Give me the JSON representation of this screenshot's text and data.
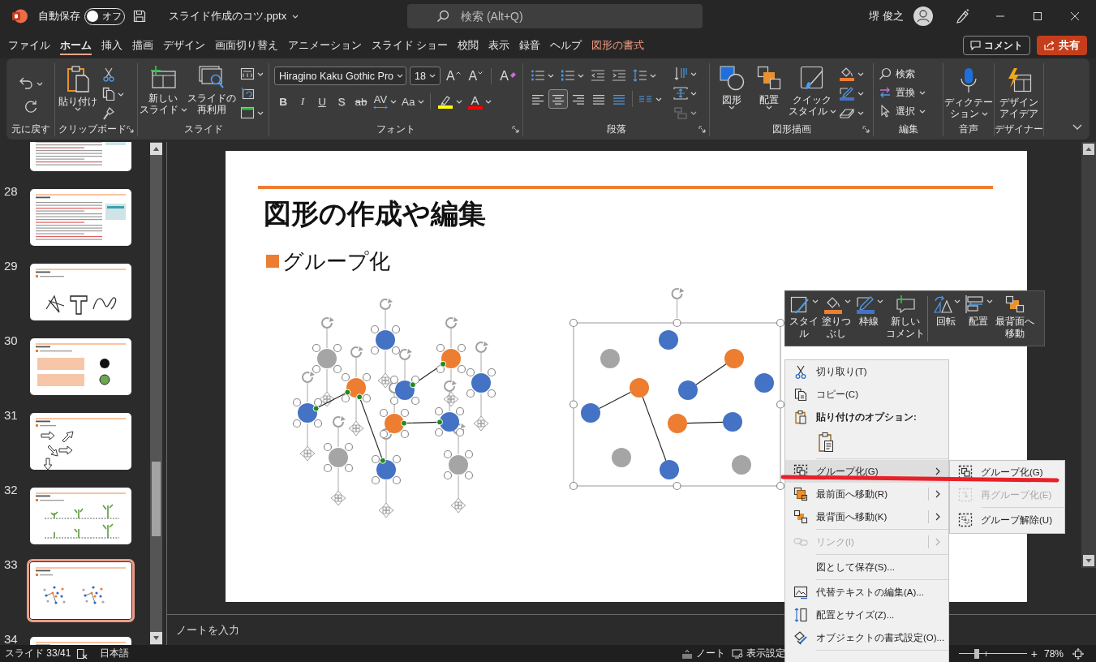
{
  "title_bar": {
    "autosave_label": "自動保存",
    "autosave": {
      "on": false,
      "label": "オフ"
    },
    "file_name": "スライド作成のコツ.pptx",
    "search": {
      "placeholder": "検索 (Alt+Q)"
    },
    "user_name": "堺 俊之"
  },
  "ribbon_tabs": [
    {
      "label": "ファイル",
      "kind": "standard",
      "selected": false
    },
    {
      "label": "ホーム",
      "kind": "standard",
      "selected": true
    },
    {
      "label": "挿入",
      "kind": "standard",
      "selected": false
    },
    {
      "label": "描画",
      "kind": "standard",
      "selected": false
    },
    {
      "label": "デザイン",
      "kind": "standard",
      "selected": false
    },
    {
      "label": "画面切り替え",
      "kind": "standard",
      "selected": false
    },
    {
      "label": "アニメーション",
      "kind": "standard",
      "selected": false
    },
    {
      "label": "スライド ショー",
      "kind": "standard",
      "selected": false
    },
    {
      "label": "校閲",
      "kind": "standard",
      "selected": false
    },
    {
      "label": "表示",
      "kind": "standard",
      "selected": false
    },
    {
      "label": "録音",
      "kind": "standard",
      "selected": false
    },
    {
      "label": "ヘルプ",
      "kind": "standard",
      "selected": false
    },
    {
      "label": "図形の書式",
      "kind": "contextual",
      "selected": false
    }
  ],
  "header_buttons": {
    "comment": "コメント",
    "share": "共有"
  },
  "ribbon": {
    "undo": {
      "group_label": "元に戻す"
    },
    "clipboard": {
      "group_label": "クリップボード",
      "paste": "貼り付け"
    },
    "slides": {
      "group_label": "スライド",
      "new_slide": [
        "新しい",
        "スライド"
      ],
      "reuse_slides": [
        "スライドの",
        "再利用"
      ]
    },
    "font": {
      "group_label": "フォント",
      "font_name": "Hiragino Kaku Gothic Pro",
      "font_size": "18",
      "grow": "A",
      "shrink": "A",
      "clear": "A",
      "styles": [
        "B",
        "I",
        "U",
        "S",
        "ab"
      ],
      "spacing": "AV",
      "case": "Aa",
      "paint": "A"
    },
    "paragraph": {
      "group_label": "段落",
      "alignment": [
        {
          "selected": false
        },
        {
          "selected": true
        },
        {
          "selected": false
        },
        {
          "selected": false
        },
        {
          "selected": false
        }
      ]
    },
    "drawing": {
      "group_label": "図形描画",
      "shapes": "図形",
      "arrange": "配置",
      "quick_styles": [
        "クイック",
        "スタイル"
      ]
    },
    "editing": {
      "group_label": "編集",
      "find": "検索",
      "replace": "置換",
      "select": "選択"
    },
    "voice": {
      "group_label": "音声",
      "dictate": [
        "ディクテー",
        "ション"
      ]
    },
    "designer": {
      "group_label": "デザイナー",
      "design_ideas": [
        "デザイン",
        "アイデア"
      ]
    }
  },
  "thumbnails": [
    {
      "kind": "text",
      "selected": false
    },
    {
      "number": "28",
      "kind": "text",
      "selected": false
    },
    {
      "number": "29",
      "kind": "freeform",
      "selected": false
    },
    {
      "number": "30",
      "kind": "boxes",
      "selected": false
    },
    {
      "number": "31",
      "kind": "arrows",
      "selected": false
    },
    {
      "number": "32",
      "kind": "plants",
      "selected": false
    },
    {
      "number": "33",
      "kind": "dots",
      "selected": true
    },
    {
      "number": "34",
      "kind": "text",
      "selected": false
    }
  ],
  "slide": {
    "title": "図形の作成や編集",
    "bullet": "グループ化",
    "diagrams": [
      {
        "grouped": false,
        "nodes": [
          {
            "color": "#a5a5a5"
          },
          {
            "color": "#4472c4"
          },
          {
            "color": "#ed7d31"
          },
          {
            "color": "#4472c4"
          },
          {
            "color": "#ed7d31"
          },
          {
            "color": "#4472c4"
          },
          {
            "color": "#4472c4"
          },
          {
            "color": "#ed7d31"
          },
          {
            "color": "#4472c4"
          },
          {
            "color": "#a5a5a5"
          },
          {
            "color": "#4472c4"
          },
          {
            "color": "#a5a5a5"
          }
        ]
      },
      {
        "grouped": true,
        "nodes": [
          {
            "color": "#a5a5a5"
          },
          {
            "color": "#4472c4"
          },
          {
            "color": "#ed7d31"
          },
          {
            "color": "#4472c4"
          },
          {
            "color": "#ed7d31"
          },
          {
            "color": "#4472c4"
          },
          {
            "color": "#4472c4"
          },
          {
            "color": "#ed7d31"
          },
          {
            "color": "#4472c4"
          },
          {
            "color": "#a5a5a5"
          },
          {
            "color": "#4472c4"
          },
          {
            "color": "#a5a5a5"
          }
        ]
      }
    ]
  },
  "notes": {
    "placeholder": "ノートを入力"
  },
  "mini_toolbar": {
    "buttons": [
      {
        "lines": [
          "スタイ",
          "ル"
        ],
        "dropdown": true
      },
      {
        "lines": [
          "塗りつ",
          "ぶし"
        ],
        "dropdown": true
      },
      {
        "lines": [
          "枠線"
        ],
        "dropdown": true
      },
      {
        "lines": [
          "新しい",
          "コメント"
        ],
        "dropdown": false
      },
      {
        "lines": [
          "回転"
        ],
        "dropdown": true
      },
      {
        "lines": [
          "配置"
        ],
        "dropdown": true
      },
      {
        "lines": [
          "最背面へ",
          "移動"
        ],
        "dropdown": false
      }
    ]
  },
  "context_menu": {
    "items": [
      {
        "kind": "command",
        "label": "切り取り(T)",
        "disabled": false
      },
      {
        "kind": "command",
        "label": "コピー(C)",
        "disabled": false
      },
      {
        "kind": "header",
        "label": "貼り付けのオプション:"
      },
      {
        "kind": "paste_options"
      },
      {
        "kind": "separator"
      },
      {
        "kind": "submenu",
        "label": "グループ化(G)",
        "disabled": false,
        "expanded": true
      },
      {
        "kind": "split",
        "label": "最前面へ移動(R)",
        "disabled": false,
        "expanded": false
      },
      {
        "kind": "split",
        "label": "最背面へ移動(K)",
        "disabled": false,
        "expanded": false
      },
      {
        "kind": "separator"
      },
      {
        "kind": "split",
        "label": "リンク(I)",
        "disabled": true,
        "expanded": false
      },
      {
        "kind": "separator"
      },
      {
        "kind": "command",
        "label": "図として保存(S)...",
        "disabled": false
      },
      {
        "kind": "separator"
      },
      {
        "kind": "command",
        "label": "代替テキストの編集(A)...",
        "disabled": false
      },
      {
        "kind": "command",
        "label": "配置とサイズ(Z)...",
        "disabled": false
      },
      {
        "kind": "command",
        "label": "オブジェクトの書式設定(O)...",
        "disabled": false
      },
      {
        "kind": "separator"
      }
    ]
  },
  "submenu": {
    "items": [
      {
        "kind": "command",
        "label": "グループ化(G)",
        "disabled": false
      },
      {
        "kind": "command",
        "label": "再グループ化(E)",
        "disabled": true
      },
      {
        "kind": "separator"
      },
      {
        "kind": "command",
        "label": "グループ解除(U)",
        "disabled": false
      }
    ]
  },
  "status_bar": {
    "slide_indicator": "スライド 33/41",
    "language": "日本語",
    "notes_button": "ノート",
    "view_settings_button": "表示設定",
    "zoom_slider": {
      "level": 0.27
    },
    "zoom_in": "+",
    "zoom_percent": "78%"
  }
}
